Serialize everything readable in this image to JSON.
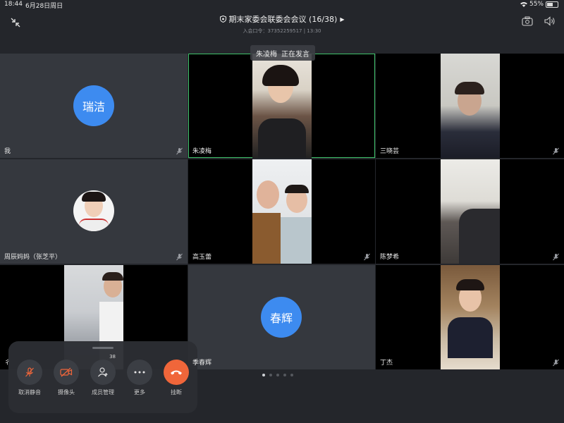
{
  "status_bar": {
    "time": "18:44",
    "date": "6月28日周日",
    "battery": "55%"
  },
  "meeting": {
    "title": "期末家委会联委会会议 (16/38)",
    "subtitle": "入会口令：37352259517 | 13:30"
  },
  "speaking": {
    "name": "朱凌梅",
    "status": "正在发言"
  },
  "tiles": [
    {
      "name": "我",
      "avatar": "瑞洁"
    },
    {
      "name": "朱凌梅"
    },
    {
      "name": "三晓芸"
    },
    {
      "name": "周辰妈妈（张芝平）"
    },
    {
      "name": "高玉蕾"
    },
    {
      "name": "陈梦希"
    },
    {
      "name": "彳"
    },
    {
      "name": "季春辉",
      "avatar": "春辉"
    },
    {
      "name": "丁杰"
    }
  ],
  "controls": {
    "unmute": "取消静音",
    "camera": "摄像头",
    "members": "成员管理",
    "member_count": "38",
    "more": "更多",
    "hangup": "挂断"
  },
  "colors": {
    "avatar_blue": "#3d8bf0",
    "active_border": "#3ec36a",
    "hangup": "#f0663a",
    "bg": "#24262b"
  }
}
